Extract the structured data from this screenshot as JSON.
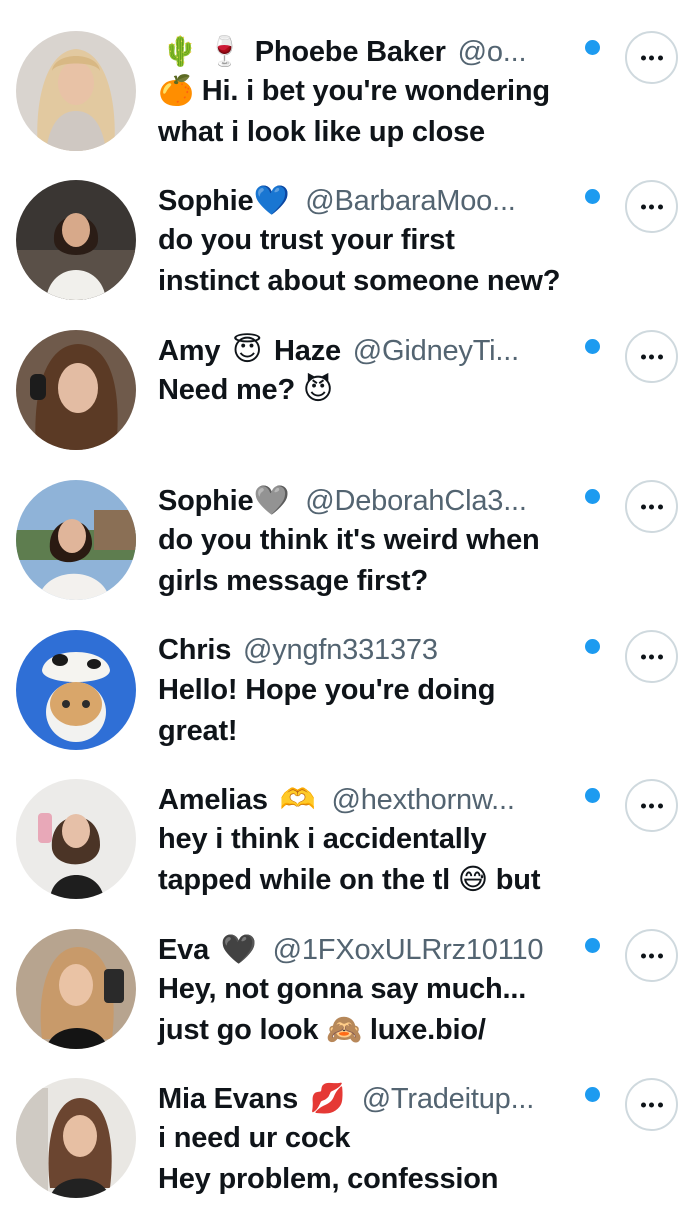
{
  "colors": {
    "accent": "#1d9bf0",
    "text_primary": "#0f1419",
    "text_secondary": "#536471",
    "button_border": "#cfd9de",
    "background": "#ffffff"
  },
  "messages": [
    {
      "prefix_emoji": "🌵 🍷",
      "name": "Phoebe Baker",
      "name_emoji": "",
      "name_suffix": "",
      "handle": "@o...",
      "text_lines": [
        "🍊 Hi. i bet you're wondering",
        "what i look like up close"
      ],
      "unread": true,
      "avatar_icon": "woman-long-blonde-hair-photo"
    },
    {
      "prefix_emoji": "",
      "name": "Sophie",
      "name_emoji": "💙",
      "name_suffix": "",
      "handle": "@BarbaraMoo...",
      "text_lines": [
        "do you trust your first",
        "instinct about someone new?"
      ],
      "unread": true,
      "avatar_icon": "woman-sitting-photo"
    },
    {
      "prefix_emoji": "",
      "name": "Amy",
      "name_emoji": "😇",
      "name_suffix": "Haze",
      "handle": "@GidneyTi...",
      "text_lines": [
        "Need me? 😈"
      ],
      "unread": true,
      "avatar_icon": "woman-headphones-photo"
    },
    {
      "prefix_emoji": "",
      "name": "Sophie",
      "name_emoji": "🩶",
      "name_suffix": "",
      "handle": "@DeborahCla3...",
      "text_lines": [
        "do you think it's weird when",
        "girls message first?"
      ],
      "unread": true,
      "avatar_icon": "woman-outdoors-photo"
    },
    {
      "prefix_emoji": "",
      "name": "Chris",
      "name_emoji": "",
      "name_suffix": "",
      "handle": "@yngfn331373",
      "text_lines": [
        "Hello! Hope you're doing",
        "great!"
      ],
      "unread": true,
      "avatar_icon": "cat-cow-hat-photo"
    },
    {
      "prefix_emoji": "",
      "name": "Amelias",
      "name_emoji": "🫶",
      "name_suffix": "",
      "handle": "@hexthornw...",
      "text_lines": [
        "hey i think i accidentally",
        "tapped while on the tl 😅 but"
      ],
      "unread": true,
      "avatar_icon": "woman-mirror-selfie-photo"
    },
    {
      "prefix_emoji": "",
      "name": "Eva",
      "name_emoji": "🖤",
      "name_suffix": "",
      "handle": "@1FXoxULRrz10110",
      "text_lines": [
        "Hey, not gonna say much...",
        "just go look 🙈 luxe.bio/"
      ],
      "unread": true,
      "avatar_icon": "woman-selfie-photo"
    },
    {
      "prefix_emoji": "",
      "name": "Mia Evans",
      "name_emoji": "💋",
      "name_suffix": "",
      "handle": "@Tradeitup...",
      "text_lines": [
        "i need ur cock",
        "Hey problem, confession"
      ],
      "unread": true,
      "avatar_icon": "woman-portrait-photo"
    }
  ]
}
